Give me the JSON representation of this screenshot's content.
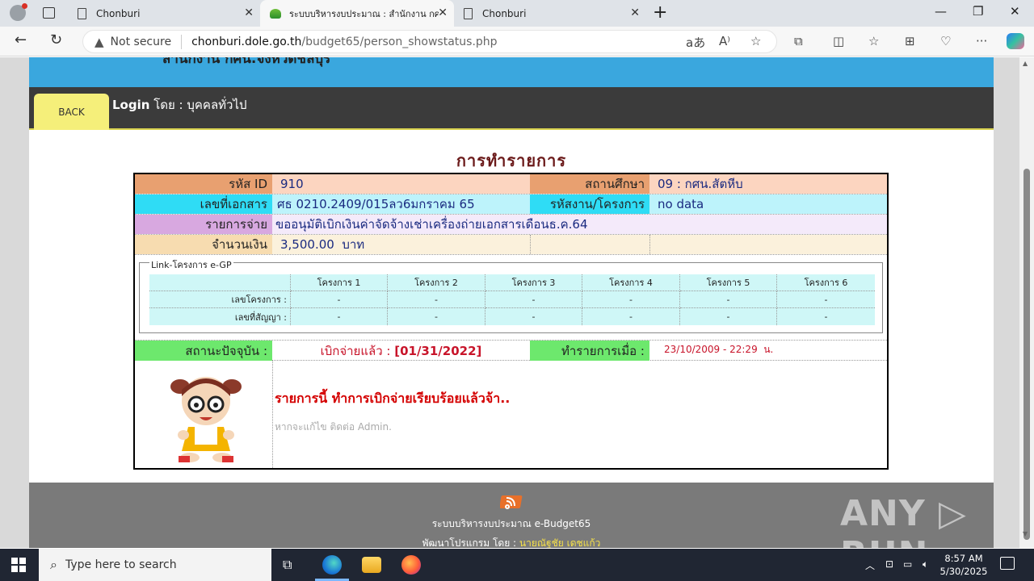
{
  "browser": {
    "tabs": [
      {
        "title": "Chonburi",
        "active": false
      },
      {
        "title": "ระบบบริหารงบประมาณ : สำนักงาน กศ",
        "active": true
      },
      {
        "title": "Chonburi",
        "active": false
      }
    ],
    "not_secure": "Not secure",
    "url_host": "chonburi.dole.go.th",
    "url_path": "/budget65/person_showstatus.php",
    "new_tab_icon": "+"
  },
  "header": {
    "banner_text": "สำนักงาน กศน.จังหวัดชลบุรี",
    "back_label": "BACK",
    "login_label": "Login",
    "login_by": " โดย : บุคคลทั่วไป"
  },
  "page_title": "การทำรายการ",
  "record": {
    "id_label": "รหัส ID",
    "id_value": "910",
    "school_label": "สถานศึกษา",
    "school_value": "09 : กศน.สัตหีบ",
    "doc_label": "เลขที่เอกสาร",
    "doc_value": "ศธ 0210.2409/015ลว6มกราคม 65",
    "project_label": "รหัสงาน/โครงการ",
    "project_value": "no data",
    "expense_label": "รายการจ่าย",
    "expense_value": "ขออนุมัติเบิกเงินค่าจัดจ้างเช่าเครื่องถ่ายเอกสารเดือนธ.ค.64",
    "amount_label": "จำนวนเงิน",
    "amount_value": "3,500.00  บาท"
  },
  "egp": {
    "legend": "Link-โครงการ e-GP",
    "columns": [
      "โครงการ 1",
      "โครงการ 2",
      "โครงการ 3",
      "โครงการ 4",
      "โครงการ 5",
      "โครงการ 6"
    ],
    "rows": [
      {
        "label": "เลขโครงการ :",
        "values": [
          "-",
          "-",
          "-",
          "-",
          "-",
          "-"
        ]
      },
      {
        "label": "เลขที่สัญญา :",
        "values": [
          "-",
          "-",
          "-",
          "-",
          "-",
          "-"
        ]
      }
    ]
  },
  "status": {
    "label": "สถานะปัจจุบัน :",
    "value_prefix": "เบิกจ่ายแล้ว : ",
    "value_date": "[01/31/2022]",
    "made_label": "ทำรายการเมื่อ :",
    "made_value": "23/10/2009 - 22:29  น."
  },
  "message": {
    "main": "รายการนี้ ทำการเบิกจ่ายเรียบร้อยแล้วจ้า..",
    "sub": "หากจะแก้ไข ติดต่อ Admin."
  },
  "footer": {
    "line1": "ระบบบริหารงบประมาณ e-Budget65",
    "line2_prefix": "พัฒนาโปรแกรม โดย : ",
    "line2_author": "นายณัฐชัย เดชแก้ว"
  },
  "watermark": "ANY ▷ RUN",
  "taskbar": {
    "search_placeholder": "Type here to search",
    "time": "8:57 AM",
    "date": "5/30/2025"
  },
  "colors": {
    "label_orange": "#e8a070",
    "value_peach": "#fcd5c0",
    "label_cyan": "#2fdcf5",
    "value_cyan": "#bdf3fb",
    "label_purple": "#d8a8e0",
    "value_lavender": "#f4eafa",
    "label_tan": "#f7dcb0",
    "value_cream": "#fbf1dc",
    "label_green": "#6de86d",
    "value_red": "#c8142a"
  }
}
